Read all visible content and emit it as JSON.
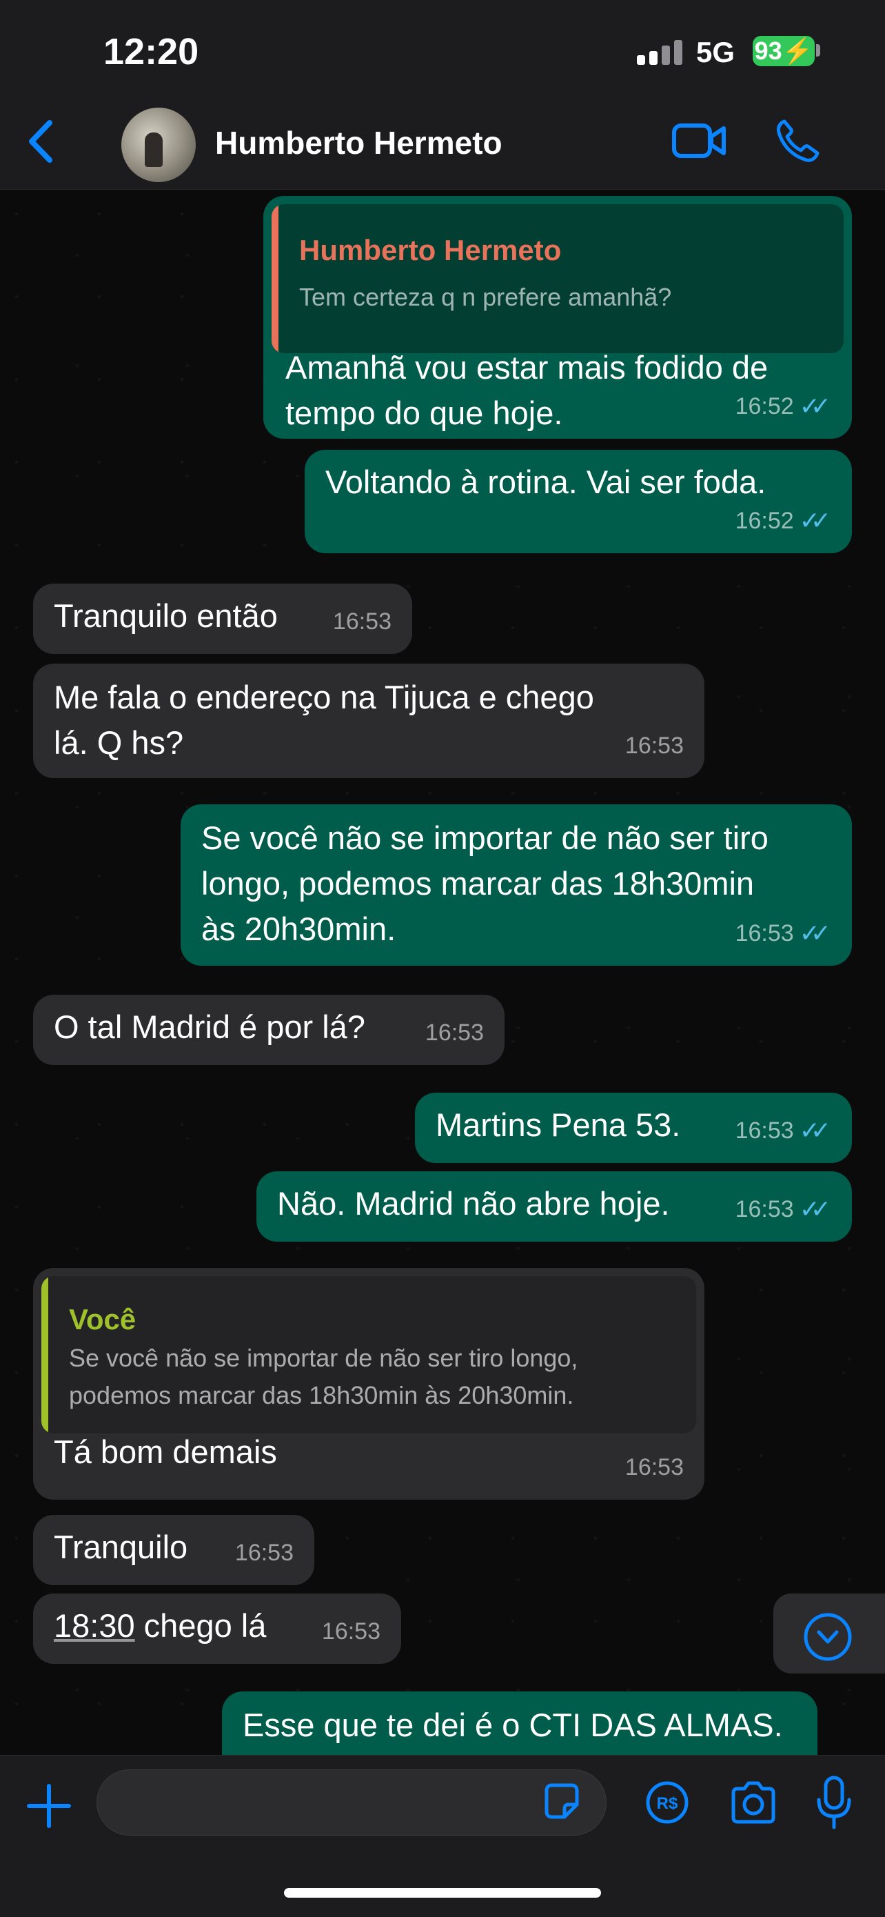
{
  "status_bar": {
    "time": "12:20",
    "network": "5G",
    "battery": "93"
  },
  "header": {
    "contact_name": "Humberto Hermeto"
  },
  "messages": [
    {
      "dir": "out",
      "quote_author": "Humberto Hermeto",
      "quote_text": "Tem certeza q n prefere amanhã?",
      "line1": "Amanhã vou estar mais fodido de",
      "line2": "tempo do que hoje.",
      "time": "16:52",
      "status": "read"
    },
    {
      "dir": "out",
      "text": "Voltando à rotina. Vai ser foda.",
      "time": "16:52",
      "status": "read"
    },
    {
      "dir": "in",
      "text": "Tranquilo então",
      "time": "16:53"
    },
    {
      "dir": "in",
      "line1": "Me fala o endereço na Tijuca e chego",
      "line2": "lá. Q hs?",
      "time": "16:53"
    },
    {
      "dir": "out",
      "line1": "Se você não se importar de não ser tiro",
      "line2": "longo, podemos marcar das 18h30min",
      "line3": "às 20h30min.",
      "time": "16:53",
      "status": "read"
    },
    {
      "dir": "in",
      "text": "O tal Madrid é por lá?",
      "time": "16:53"
    },
    {
      "dir": "out",
      "text": "Martins Pena 53.",
      "time": "16:53",
      "status": "read"
    },
    {
      "dir": "out",
      "text": "Não. Madrid não abre hoje.",
      "time": "16:53",
      "status": "read"
    },
    {
      "dir": "in",
      "quote_author": "Você",
      "quote_line1": "Se você não se importar de não ser tiro longo,",
      "quote_line2": "podemos marcar das 18h30min às 20h30min.",
      "text": "Tá bom demais",
      "time": "16:53"
    },
    {
      "dir": "in",
      "text": "Tranquilo",
      "time": "16:53"
    },
    {
      "dir": "in",
      "link": "18:30",
      "text": " chego lá",
      "time": "16:53"
    },
    {
      "dir": "out",
      "text": "Esse que te dei é o CTI DAS ALMAS."
    }
  ],
  "colors": {
    "outgoing": "#005c4b",
    "incoming": "#2c2c2e",
    "accent": "#0a84ff",
    "read_ticks": "#53bdeb",
    "quote_author_1": "#e8735a",
    "quote_author_2": "#9fc22a"
  },
  "icons": [
    "back-chevron-icon",
    "video-call-icon",
    "phone-icon",
    "double-check-icon",
    "chevron-down-circle-icon",
    "plus-icon",
    "sticker-icon",
    "pix-icon",
    "camera-icon",
    "microphone-icon"
  ]
}
